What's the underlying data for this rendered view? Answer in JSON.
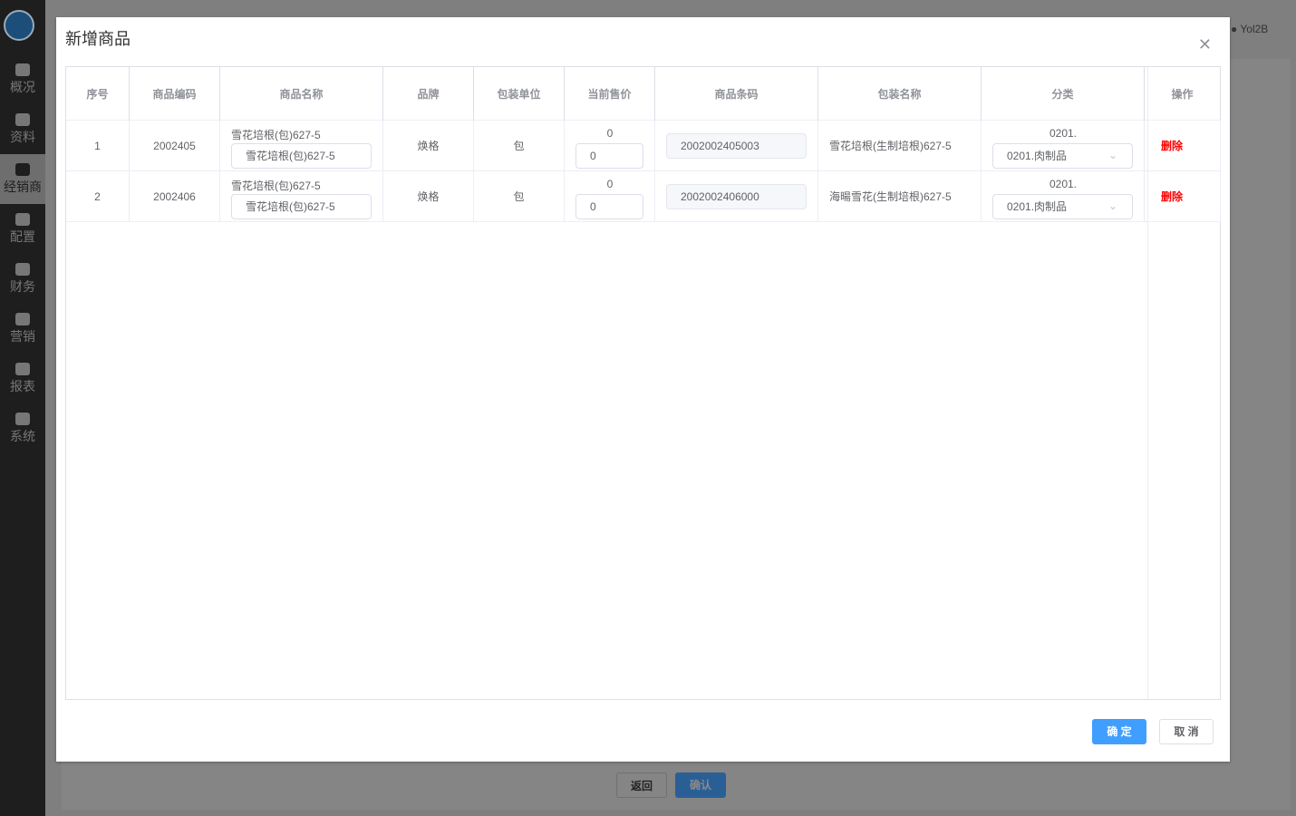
{
  "sidebar": {
    "items": [
      {
        "label": "概况"
      },
      {
        "label": "资料"
      },
      {
        "label": "经销商"
      },
      {
        "label": "配置"
      },
      {
        "label": "财务"
      },
      {
        "label": "营销"
      },
      {
        "label": "报表"
      },
      {
        "label": "系统"
      }
    ]
  },
  "header": {
    "user": "Yol2B"
  },
  "background": {
    "back_label": "返回",
    "confirm_label": "确认"
  },
  "modal": {
    "title": "新增商品",
    "ok_label": "确 定",
    "cancel_label": "取 消",
    "columns": [
      "序号",
      "商品编码",
      "商品名称",
      "品牌",
      "包装单位",
      "当前售价",
      "商品条码",
      "包装名称",
      "分类",
      "操作"
    ],
    "rows": [
      {
        "index": "1",
        "code": "2002405",
        "name": "雪花培根(包)627-5",
        "name_input": "雪花培根(包)627-5",
        "brand": "焕格",
        "unit": "包",
        "price": "0",
        "price_input": "0",
        "barcode": "2002002405003",
        "pack_name": "雪花培根(生制培根)627-5",
        "category": "0201.",
        "category_select": "0201.肉制品",
        "action": "删除"
      },
      {
        "index": "2",
        "code": "2002406",
        "name": "雪花培根(包)627-5",
        "name_input": "雪花培根(包)627-5",
        "brand": "焕格",
        "unit": "包",
        "price": "0",
        "price_input": "0",
        "barcode": "2002002406000",
        "pack_name": "海暘雪花(生制培根)627-5",
        "category": "0201.",
        "category_select": "0201.肉制品",
        "action": "删除"
      }
    ]
  }
}
